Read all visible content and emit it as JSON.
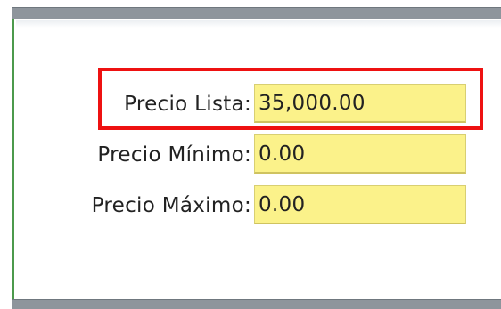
{
  "form": {
    "fields": [
      {
        "label": "Precio Lista:",
        "value": "35,000.00"
      },
      {
        "label": "Precio Mínimo:",
        "value": "0.00"
      },
      {
        "label": "Precio Máximo:",
        "value": "0.00"
      }
    ]
  },
  "colors": {
    "field_background": "#fbf28a",
    "highlight": "#ee1111",
    "panel_border": "#4c9a4c"
  }
}
